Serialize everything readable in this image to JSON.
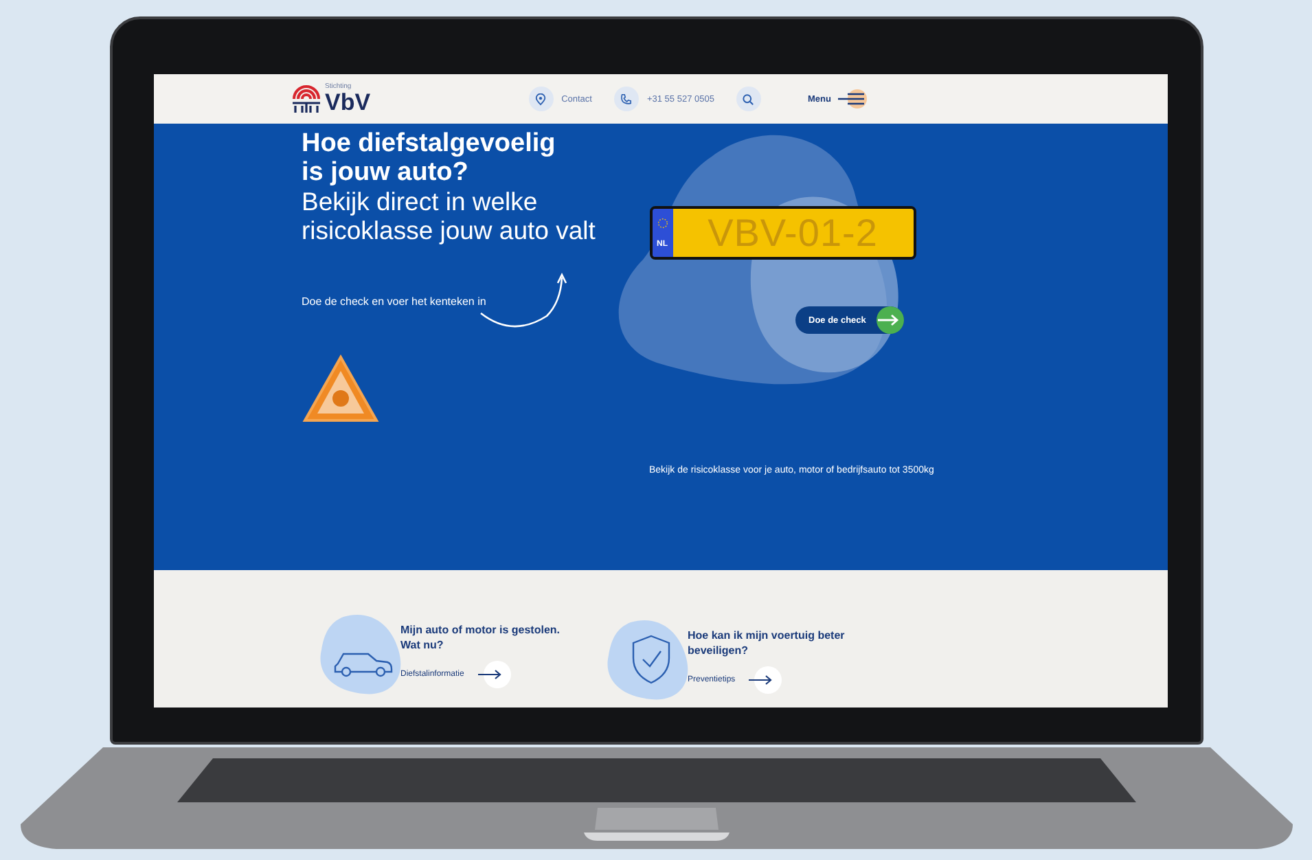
{
  "header": {
    "logo": {
      "tagline": "Stichting",
      "name": "VbV"
    },
    "nav": [
      {
        "kind": "location",
        "label": "Contact"
      },
      {
        "kind": "phone",
        "label": "+31 55 527 0505"
      },
      {
        "kind": "search"
      }
    ],
    "menu": {
      "label": "Menu"
    }
  },
  "hero": {
    "title": "Hoe diefstalgevoelig is jouw auto?",
    "subtitle": "Bekijk direct in welke risicoklasse jouw auto valt",
    "prompt": "Doe de check en voer het kenteken in",
    "plate": {
      "country": "NL",
      "number": "VBV-01-2"
    },
    "button": "Doe de check",
    "note": "Bekijk de risicoklasse voor je auto, motor of bedrijfsauto tot 3500kg"
  },
  "cards": [
    {
      "kind": "car",
      "title": "Mijn auto of motor is gestolen. Wat nu?",
      "link": "Diefstalinformatie"
    },
    {
      "kind": "shield",
      "title": "Hoe kan ik mijn voertuig beter beveiligen?",
      "link": "Preventietips"
    }
  ]
}
